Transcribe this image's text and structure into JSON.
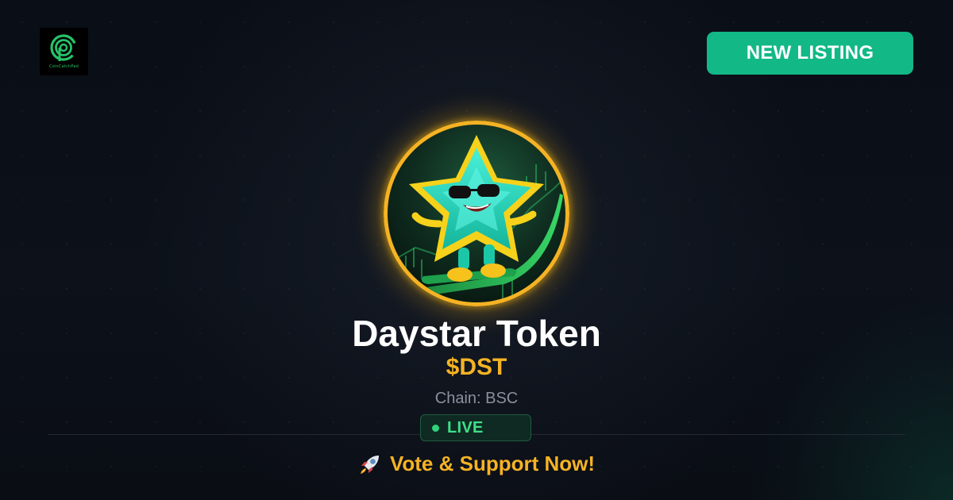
{
  "brand": {
    "logo_text": "CoinCatchPad",
    "logo_color": "#25c468"
  },
  "header": {
    "badge_label": "NEW LISTING",
    "badge_color": "#12b886"
  },
  "token": {
    "name": "Daystar Token",
    "symbol": "$DST",
    "chain": "Chain: BSC",
    "status": "LIVE",
    "avatar_icon": "star-mascot-icon",
    "avatar_ring_color": "#f5b324"
  },
  "cta": {
    "icon": "rocket-icon",
    "label": "Vote & Support Now!"
  },
  "colors": {
    "accent_green": "#12b886",
    "accent_gold": "#f5b324",
    "live_green": "#3ee08a",
    "background": "#0b0f17"
  }
}
